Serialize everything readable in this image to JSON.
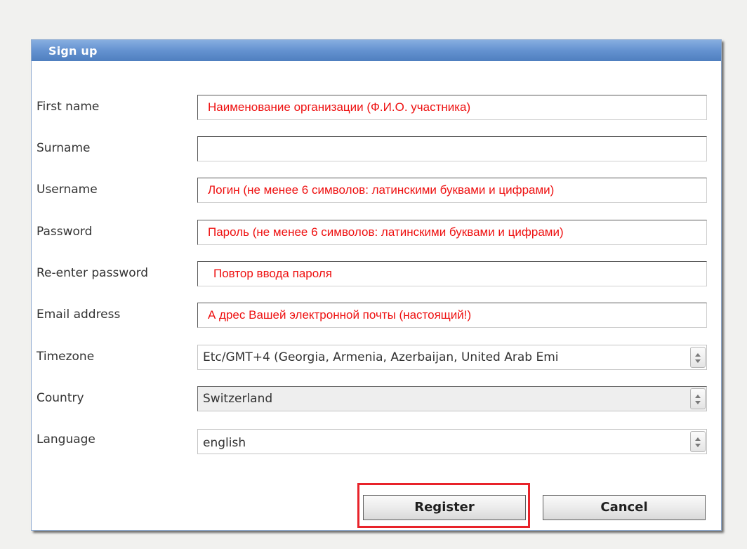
{
  "dialog": {
    "title": "Sign up",
    "title_color": "#6492d0"
  },
  "fields": [
    {
      "label": "First name",
      "value": "Наименование  организации (Ф.И.О. участника)"
    },
    {
      "label": "Surname",
      "value": ""
    },
    {
      "label": "Username",
      "value": "Логин (не менее 6 символов: латинскими буквами и цифрами)"
    },
    {
      "label": "Password",
      "value": "Пароль (не менее 6 символов: латинскими буквами и цифрами)"
    },
    {
      "label": "Re-enter password",
      "value": "Повтор ввода пароля"
    },
    {
      "label": "Email address",
      "value": "А дрес Вашей электронной почты (настоящий!)"
    }
  ],
  "selects": [
    {
      "label": "Timezone",
      "value": "Etc/GMT+4 (Georgia, Armenia, Azerbaijan, United Arab Emi"
    },
    {
      "label": "Country",
      "value": "Switzerland"
    },
    {
      "label": "Language",
      "value": "english"
    }
  ],
  "buttons": {
    "register": "Register",
    "cancel": "Cancel"
  },
  "annotation": {
    "highlight_color": "#e8232a",
    "field_text_color": "#ee1111"
  }
}
